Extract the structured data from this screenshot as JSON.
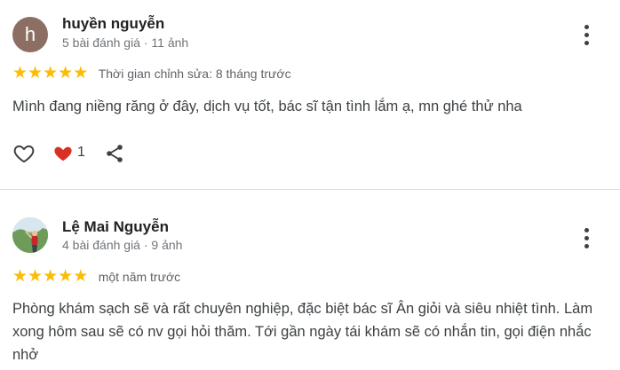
{
  "reviews": [
    {
      "avatar_letter": "h",
      "name": "huyền nguyễn",
      "meta": "5 bài đánh giá · 11 ảnh",
      "rating": 5,
      "stars": [
        "★",
        "★",
        "★",
        "★",
        "★"
      ],
      "time": "Thời gian chỉnh sửa: 8 tháng trước",
      "text": "Mình đang niềng răng ở đây, dịch vụ tốt, bác sĩ tận tình lắm ạ, mn ghé thử nha",
      "reaction_count": "1"
    },
    {
      "name": "Lệ Mai Nguyễn",
      "meta": "4 bài đánh giá · 9 ảnh",
      "rating": 5,
      "stars": [
        "★",
        "★",
        "★",
        "★",
        "★"
      ],
      "time": "một năm trước",
      "text": "Phòng khám sạch sẽ và rất chuyên nghiệp, đặc biệt bác sĩ Ân giỏi và siêu nhiệt tình. Làm xong hôm sau sẽ có nv gọi hỏi thăm. Tới gần ngày tái khám sẽ có nhắn tin, gọi điện nhắc nhở"
    }
  ],
  "icons": {
    "more": "more-vert-icon",
    "like": "heart-outline-icon",
    "reaction": "heart-filled-icon",
    "share": "share-icon"
  },
  "colors": {
    "star": "#fbbc04",
    "reaction_heart": "#d93025",
    "avatar_letter_bg": "#8d6e63"
  }
}
